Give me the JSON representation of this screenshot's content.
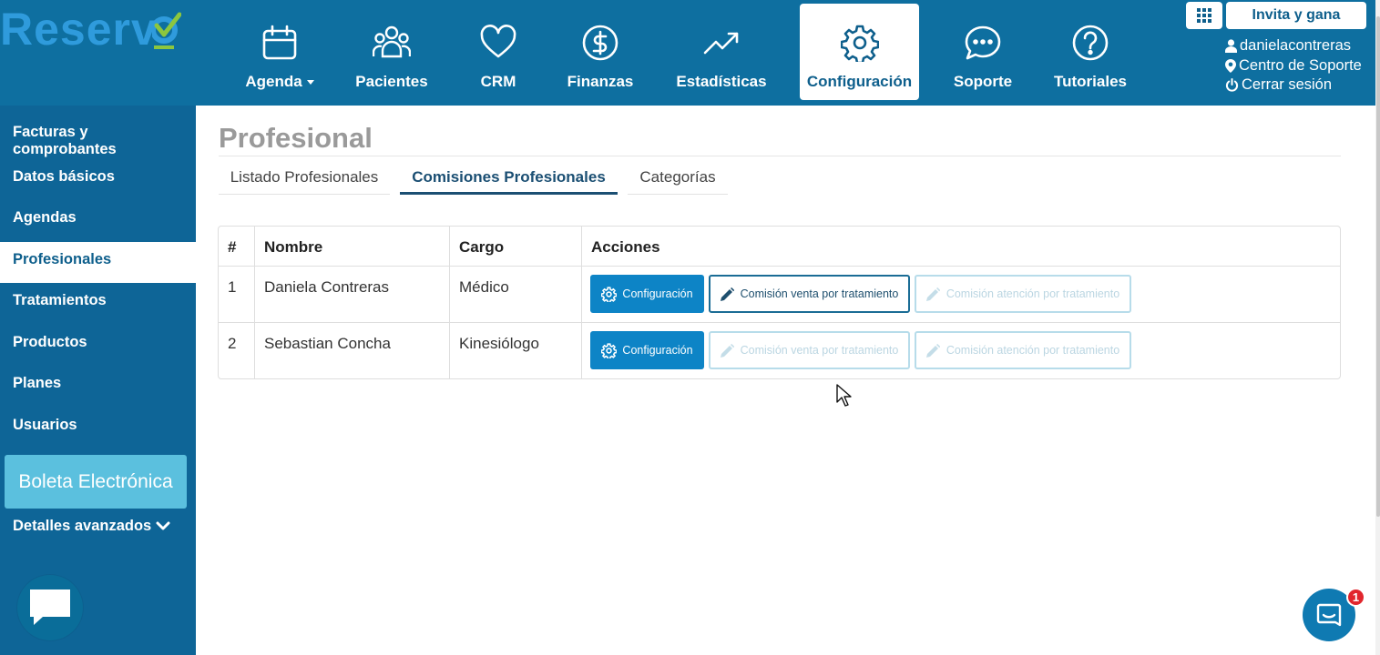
{
  "brand": {
    "logo_text": "Reserv",
    "logo_color": "#2f9bdc",
    "check_color": "#8cc63f"
  },
  "colors": {
    "header_bg": "#0e6fa0",
    "sidebar_bg": "#0e6597",
    "primary_button": "#0d84c6",
    "boleta_bg": "#5bc0de"
  },
  "nav": [
    {
      "label": "Agenda",
      "icon": "calendar-icon",
      "has_dropdown": true
    },
    {
      "label": "Pacientes",
      "icon": "users-icon"
    },
    {
      "label": "CRM",
      "icon": "heart-icon"
    },
    {
      "label": "Finanzas",
      "icon": "dollar-icon"
    },
    {
      "label": "Estadísticas",
      "icon": "trend-up-icon"
    },
    {
      "label": "Configuración",
      "icon": "gear-icon",
      "active": true
    },
    {
      "label": "Soporte",
      "icon": "chat-icon"
    },
    {
      "label": "Tutoriales",
      "icon": "help-icon"
    }
  ],
  "header_right": {
    "invite_label": "Invita y gana",
    "username": "danielacontreras",
    "support_link": "Centro de Soporte",
    "logout_link": "Cerrar sesión"
  },
  "sidebar": {
    "items": [
      {
        "label_line1": "Facturas y",
        "label_line2": "comprobantes"
      },
      {
        "label": "Datos básicos"
      },
      {
        "label": "Agendas"
      },
      {
        "label": "Profesionales",
        "active": true
      },
      {
        "label": "Tratamientos"
      },
      {
        "label": "Productos"
      },
      {
        "label": "Planes"
      },
      {
        "label": "Usuarios"
      }
    ],
    "boleta_label": "Boleta Electrónica",
    "advanced_label": "Detalles avanzados"
  },
  "page": {
    "title": "Profesional",
    "tabs": [
      {
        "label": "Listado Profesionales"
      },
      {
        "label": "Comisiones Profesionales",
        "active": true
      },
      {
        "label": "Categorías"
      }
    ]
  },
  "table": {
    "headers": [
      "#",
      "Nombre",
      "Cargo",
      "Acciones"
    ],
    "rows": [
      {
        "num": "1",
        "name": "Daniela Contreras",
        "role": "Médico",
        "sale_enabled": true
      },
      {
        "num": "2",
        "name": "Sebastian Concha",
        "role": "Kinesiólogo",
        "sale_enabled": false
      }
    ],
    "actions": {
      "config_label": "Configuración",
      "sale_label": "Comisión venta por tratamiento",
      "attention_label": "Comisión atención por tratamiento"
    }
  },
  "intercom": {
    "badge_count": "1"
  }
}
